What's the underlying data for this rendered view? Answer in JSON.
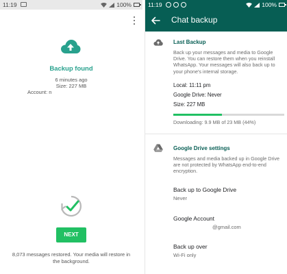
{
  "left": {
    "status": {
      "time": "11:19",
      "battery": "100%"
    },
    "title": "Backup found",
    "when": "6 minutes ago",
    "size": "Size: 227 MB",
    "account": "Account: n",
    "next_label": "NEXT",
    "restored": "8,073 messages restored. Your media will restore in the background."
  },
  "right": {
    "status": {
      "time": "11:19",
      "battery": "100%"
    },
    "appbar_title": "Chat backup",
    "last_backup": {
      "title": "Last Backup",
      "description": "Back up your messages and media to Google Drive. You can restore them when you reinstall WhatsApp. Your messages will also back up to your phone's internal storage.",
      "local": "Local: 11:11 pm",
      "google_drive": "Google Drive: Never",
      "size": "Size: 227 MB",
      "progress_percent": 44,
      "downloading": "Downloading: 9.9 MB of 23 MB (44%)"
    },
    "drive_settings": {
      "title": "Google Drive settings",
      "description": "Messages and media backed up in Google Drive are not protected by WhatsApp end-to-end encryption.",
      "backup_to_drive": {
        "title": "Back up to Google Drive",
        "value": "Never"
      },
      "google_account": {
        "title": "Google Account",
        "value": "@gmail.com"
      },
      "backup_over": {
        "title": "Back up over",
        "value": "Wi-Fi only"
      }
    }
  },
  "colors": {
    "teal_dark": "#075e54",
    "teal": "#28a18d",
    "green": "#21c063"
  },
  "icons": [
    "cloud-upload-icon",
    "restore-check-icon",
    "back-arrow-icon",
    "google-drive-icon",
    "more-vert-icon",
    "battery-icon"
  ]
}
